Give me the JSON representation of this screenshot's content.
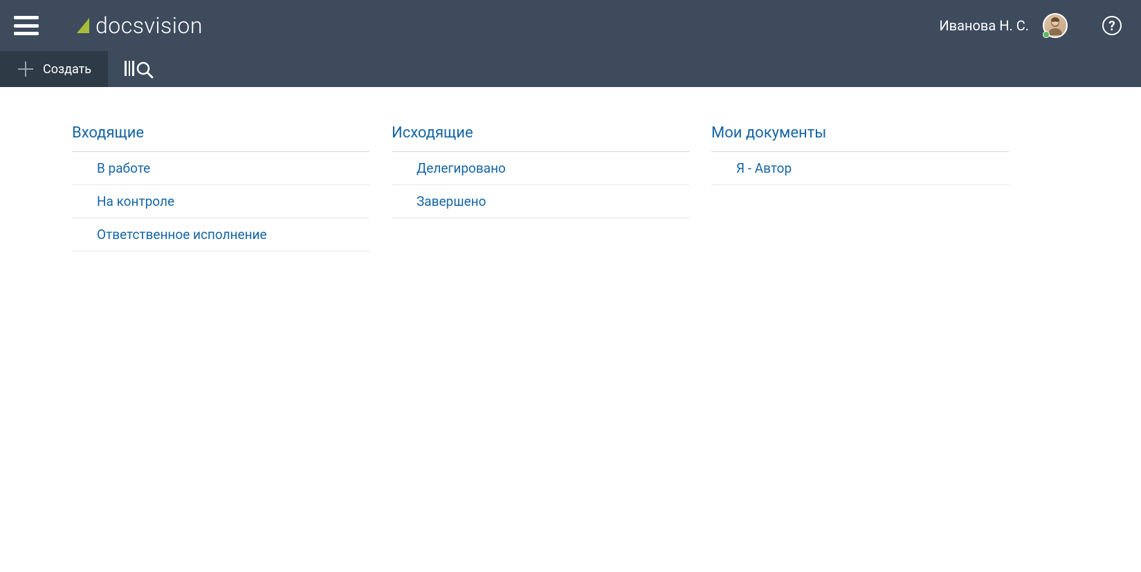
{
  "header": {
    "logo_text": "docsvision",
    "user_name": "Иванова Н. С."
  },
  "toolbar": {
    "create_label": "Создать"
  },
  "columns": [
    {
      "title": "Входящие",
      "items": [
        "В работе",
        "На контроле",
        "Ответственное исполнение"
      ]
    },
    {
      "title": "Исходящие",
      "items": [
        "Делегировано",
        "Завершено"
      ]
    },
    {
      "title": "Мои документы",
      "items": [
        "Я - Автор"
      ]
    }
  ]
}
